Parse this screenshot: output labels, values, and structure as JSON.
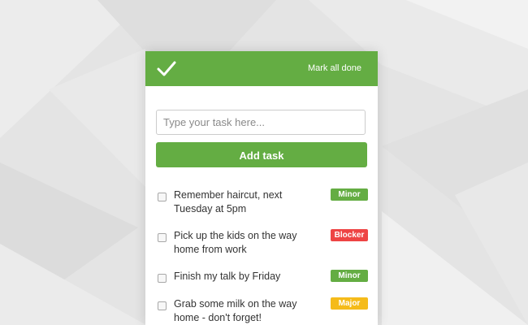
{
  "colors": {
    "accent": "#64ad43",
    "minor": "#64ad43",
    "blocker": "#ee4444",
    "major": "#f5bb1a"
  },
  "header": {
    "logo_icon": "checkmark-icon",
    "mark_all_label": "Mark all done"
  },
  "form": {
    "placeholder": "Type your task here...",
    "value": "",
    "add_label": "Add task"
  },
  "tasks": [
    {
      "text": "Remember haircut, next Tuesday at 5pm",
      "tag": "Minor",
      "checked": false
    },
    {
      "text": "Pick up the kids on the way home from work",
      "tag": "Blocker",
      "checked": false
    },
    {
      "text": "Finish my talk by Friday",
      "tag": "Minor",
      "checked": false
    },
    {
      "text": "Grab some milk on the way home - don't forget!",
      "tag": "Major",
      "checked": false
    }
  ]
}
